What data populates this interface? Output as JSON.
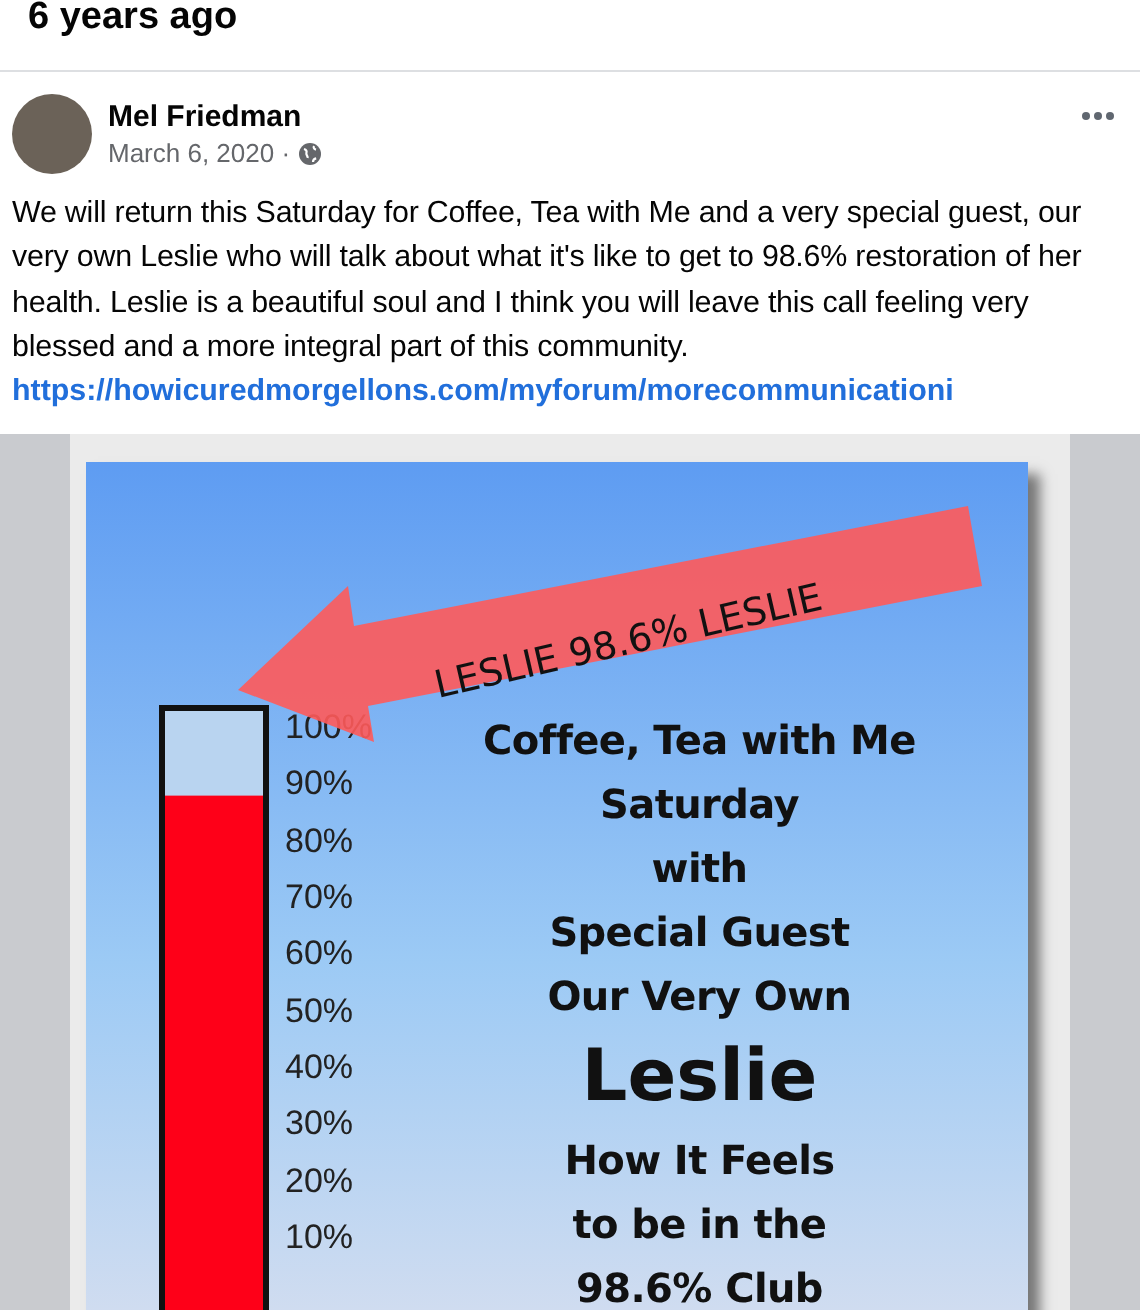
{
  "section_heading": "6 years ago",
  "post": {
    "author": "Mel Friedman",
    "date": "March 6, 2020 ·",
    "body": "We will return this Saturday for Coffee, Tea with Me and a very special guest, our very own Leslie who will talk about what it's like to get to 98.6% restoration of her health. Leslie is a beautiful soul and I think you will leave this call feeling very blessed and a more integral part of this community.",
    "link": "https://howicuredmorgellons.com/myforum/morecommunicationi"
  },
  "poster": {
    "arrow_text": "LESLIE 98.6% LESLIE",
    "thermometer": {
      "level": 0.93,
      "scale": [
        "100%",
        "90%",
        "80%",
        "70%",
        "60%",
        "50%",
        "40%",
        "30%",
        "20%",
        "10%"
      ]
    },
    "lines": [
      {
        "text": "Coffee, Tea with Me",
        "kind": "normal"
      },
      {
        "text": "Saturday",
        "kind": "normal"
      },
      {
        "text": "with",
        "kind": "normal"
      },
      {
        "text": "Special Guest",
        "kind": "normal"
      },
      {
        "text": "Our Very Own",
        "kind": "normal"
      },
      {
        "text": "Leslie",
        "kind": "big"
      },
      {
        "text": "How It Feels",
        "kind": "normal"
      },
      {
        "text": "to be in the",
        "kind": "normal"
      },
      {
        "text": "98.6% Club",
        "kind": "normal"
      }
    ]
  }
}
